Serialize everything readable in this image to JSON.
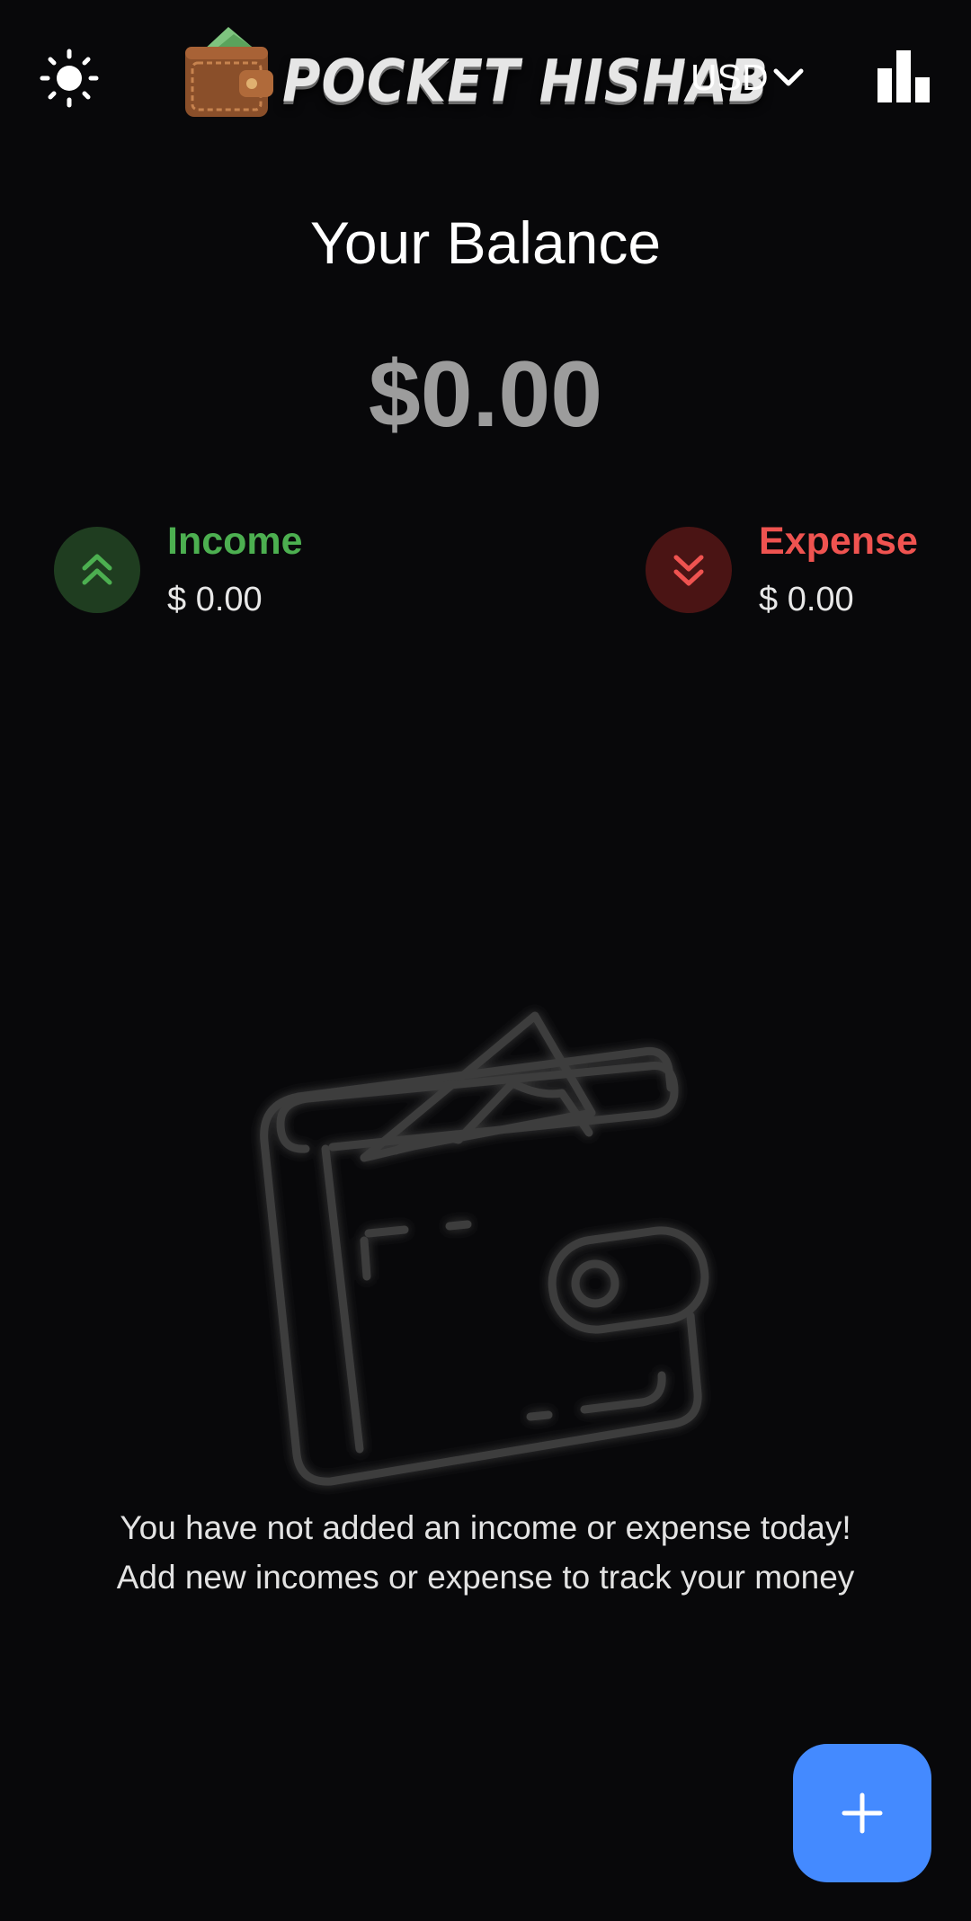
{
  "header": {
    "app_name": "POCKET HISHAB",
    "currency": "USD",
    "theme_icon": "sun-icon",
    "stats_icon": "bar-chart-icon",
    "dropdown_icon": "chevron-down-icon"
  },
  "balance": {
    "title": "Your Balance",
    "amount": "$0.00"
  },
  "summary": {
    "income": {
      "label": "Income",
      "value": "$ 0.00",
      "icon": "double-chevron-up-icon",
      "color": "#4caf50"
    },
    "expense": {
      "label": "Expense",
      "value": "$ 0.00",
      "icon": "double-chevron-down-icon",
      "color": "#ef5350"
    }
  },
  "empty_state": {
    "icon": "wallet-icon",
    "line1": "You have not added an income or expense today!",
    "line2": "Add new incomes or expense to track your money"
  },
  "fab": {
    "icon": "plus-icon",
    "color": "#448aff"
  }
}
